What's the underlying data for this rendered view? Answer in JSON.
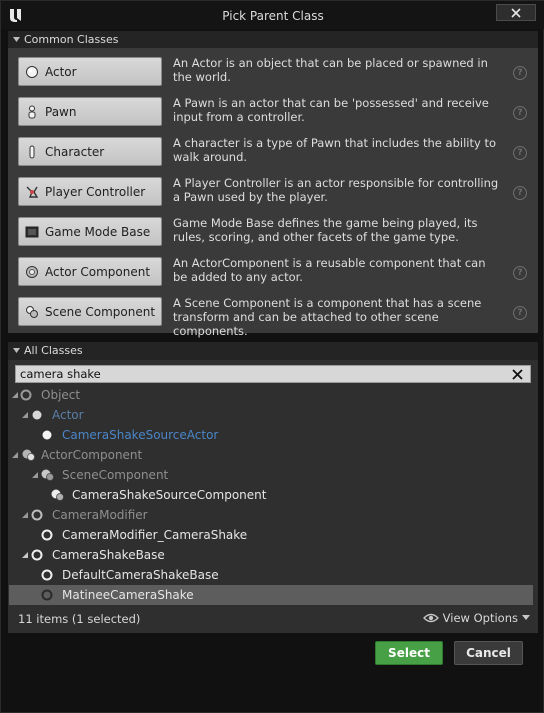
{
  "window": {
    "title": "Pick Parent Class"
  },
  "common_classes": {
    "header": "Common Classes",
    "items": [
      {
        "label": "Actor",
        "icon": "actor-icon",
        "description": "An Actor is an object that can be placed or spawned in the world."
      },
      {
        "label": "Pawn",
        "icon": "pawn-icon",
        "description": "A Pawn is an actor that can be 'possessed' and receive input from a controller."
      },
      {
        "label": "Character",
        "icon": "character-icon",
        "description": "A character is a type of Pawn that includes the ability to walk around."
      },
      {
        "label": "Player Controller",
        "icon": "player-controller-icon",
        "description": "A Player Controller is an actor responsible for controlling a Pawn used by the player."
      },
      {
        "label": "Game Mode Base",
        "icon": "game-mode-icon",
        "description": "Game Mode Base defines the game being played, its rules, scoring, and other facets of the game type."
      },
      {
        "label": "Actor Component",
        "icon": "actor-component-icon",
        "description": "An ActorComponent is a reusable component that can be added to any actor."
      },
      {
        "label": "Scene Component",
        "icon": "scene-component-icon",
        "description": "A Scene Component is a component that has a scene transform and can be attached to other scene components."
      }
    ]
  },
  "all_classes": {
    "header": "All Classes",
    "search_value": "camera shake",
    "tree": [
      {
        "label": "Object",
        "depth": 0,
        "expanded": true,
        "tone": "grey",
        "icon": "object-icon"
      },
      {
        "label": "Actor",
        "depth": 1,
        "expanded": true,
        "tone": "blue-dim",
        "icon": "actor-icon"
      },
      {
        "label": "CameraShakeSourceActor",
        "depth": 2,
        "expanded": null,
        "tone": "blue",
        "icon": "actor-icon"
      },
      {
        "label": "ActorComponent",
        "depth": 1,
        "expanded": true,
        "tone": "grey",
        "icon": "actor-component-icon"
      },
      {
        "label": "SceneComponent",
        "depth": 2,
        "expanded": true,
        "tone": "grey",
        "icon": "scene-component-icon"
      },
      {
        "label": "CameraShakeSourceComponent",
        "depth": 3,
        "expanded": null,
        "tone": "white",
        "icon": "scene-component-icon"
      },
      {
        "label": "CameraModifier",
        "depth": 1,
        "expanded": true,
        "tone": "grey",
        "icon": "object-icon"
      },
      {
        "label": "CameraModifier_CameraShake",
        "depth": 2,
        "expanded": null,
        "tone": "white",
        "icon": "object-icon"
      },
      {
        "label": "CameraShakeBase",
        "depth": 1,
        "expanded": true,
        "tone": "white",
        "icon": "object-icon"
      },
      {
        "label": "DefaultCameraShakeBase",
        "depth": 2,
        "expanded": null,
        "tone": "white",
        "icon": "object-icon"
      },
      {
        "label": "MatineeCameraShake",
        "depth": 2,
        "expanded": null,
        "tone": "white",
        "icon": "object-icon",
        "selected": true
      }
    ],
    "status": "11 items (1 selected)",
    "view_options": "View Options"
  },
  "buttons": {
    "select": "Select",
    "cancel": "Cancel"
  },
  "colors": {
    "select_green": "#47a045",
    "tree_blue": "#4a86c8",
    "selected_row": "#5d5d5d"
  }
}
